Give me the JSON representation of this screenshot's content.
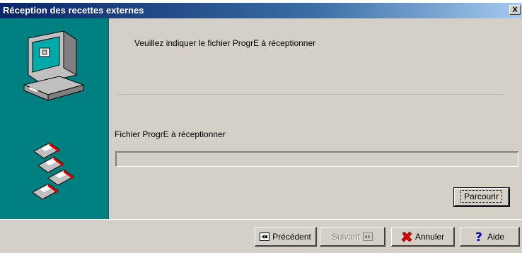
{
  "window": {
    "title": "Réception des recettes externes",
    "close_label": "X"
  },
  "main": {
    "instruction": "Veuillez indiquer le fichier ProgrE à réceptionner",
    "field_label": "Fichier ProgrE à réceptionner",
    "field_value": "",
    "browse_label": "Parcourir"
  },
  "footer": {
    "prev_label": "Précédent",
    "next_label": "Suivant",
    "cancel_label": "Annuler",
    "help_label": "Aide"
  },
  "colors": {
    "side_panel": "#008080",
    "face": "#d4d0c8",
    "title_start": "#0a246a"
  },
  "icons": [
    "computer-icon",
    "diskettes-icon",
    "close-icon",
    "previous-icon",
    "next-icon",
    "cancel-x-icon",
    "help-question-icon"
  ]
}
